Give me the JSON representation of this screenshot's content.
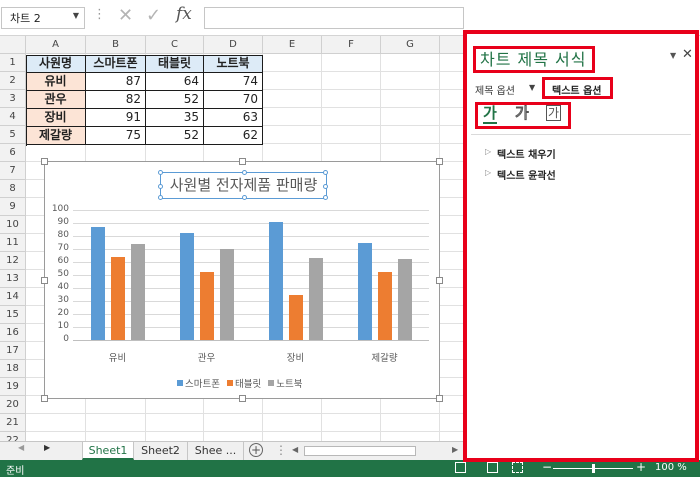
{
  "formula_bar": {
    "name_box": "차트 2",
    "fx_label": "fx",
    "formula_value": ""
  },
  "grid": {
    "columns": [
      "A",
      "B",
      "C",
      "D",
      "E",
      "F",
      "G"
    ],
    "rows": [
      "1",
      "2",
      "3",
      "4",
      "5",
      "6",
      "7",
      "8",
      "9",
      "10",
      "11",
      "12",
      "13",
      "14",
      "15",
      "16",
      "17",
      "18",
      "19",
      "20",
      "21",
      "22"
    ]
  },
  "table": {
    "headers": [
      "사원명",
      "스마트폰",
      "태블릿",
      "노트북"
    ],
    "rows": [
      [
        "유비",
        "87",
        "64",
        "74"
      ],
      [
        "관우",
        "82",
        "52",
        "70"
      ],
      [
        "장비",
        "91",
        "35",
        "63"
      ],
      [
        "제갈량",
        "75",
        "52",
        "62"
      ]
    ]
  },
  "chart_data": {
    "type": "bar",
    "title": "사원별 전자제품 판매량",
    "categories": [
      "유비",
      "관우",
      "장비",
      "제갈량"
    ],
    "series": [
      {
        "name": "스마트폰",
        "values": [
          87,
          82,
          91,
          75
        ],
        "color": "#5b9bd5"
      },
      {
        "name": "태블릿",
        "values": [
          64,
          52,
          35,
          52
        ],
        "color": "#ed7d31"
      },
      {
        "name": "노트북",
        "values": [
          74,
          70,
          63,
          62
        ],
        "color": "#a5a5a5"
      }
    ],
    "ylim": [
      0,
      100
    ],
    "yticks": [
      "100",
      "90",
      "80",
      "70",
      "60",
      "50",
      "40",
      "30",
      "20",
      "10",
      "0"
    ],
    "legend_position": "bottom",
    "grid": true
  },
  "sheet_tabs": {
    "tabs": [
      "Sheet1",
      "Sheet2",
      "Shee ..."
    ],
    "active": "Sheet1"
  },
  "status_bar": {
    "ready": "준비",
    "zoom": "100 %",
    "zoom_minus": "−",
    "zoom_plus": "+"
  },
  "format_pane": {
    "title": "차트 제목 서식",
    "tab_title_options": "제목 옵션",
    "tab_text_options": "텍스트 옵션",
    "icon_labels": [
      "가",
      "가",
      "가"
    ],
    "sections": [
      "텍스트 채우기",
      "텍스트 윤곽선"
    ]
  },
  "colors": {
    "excel_green": "#217346",
    "highlight_red": "#e8001a",
    "header_fill": "#ddebf7",
    "name_fill": "#fce4d6"
  }
}
